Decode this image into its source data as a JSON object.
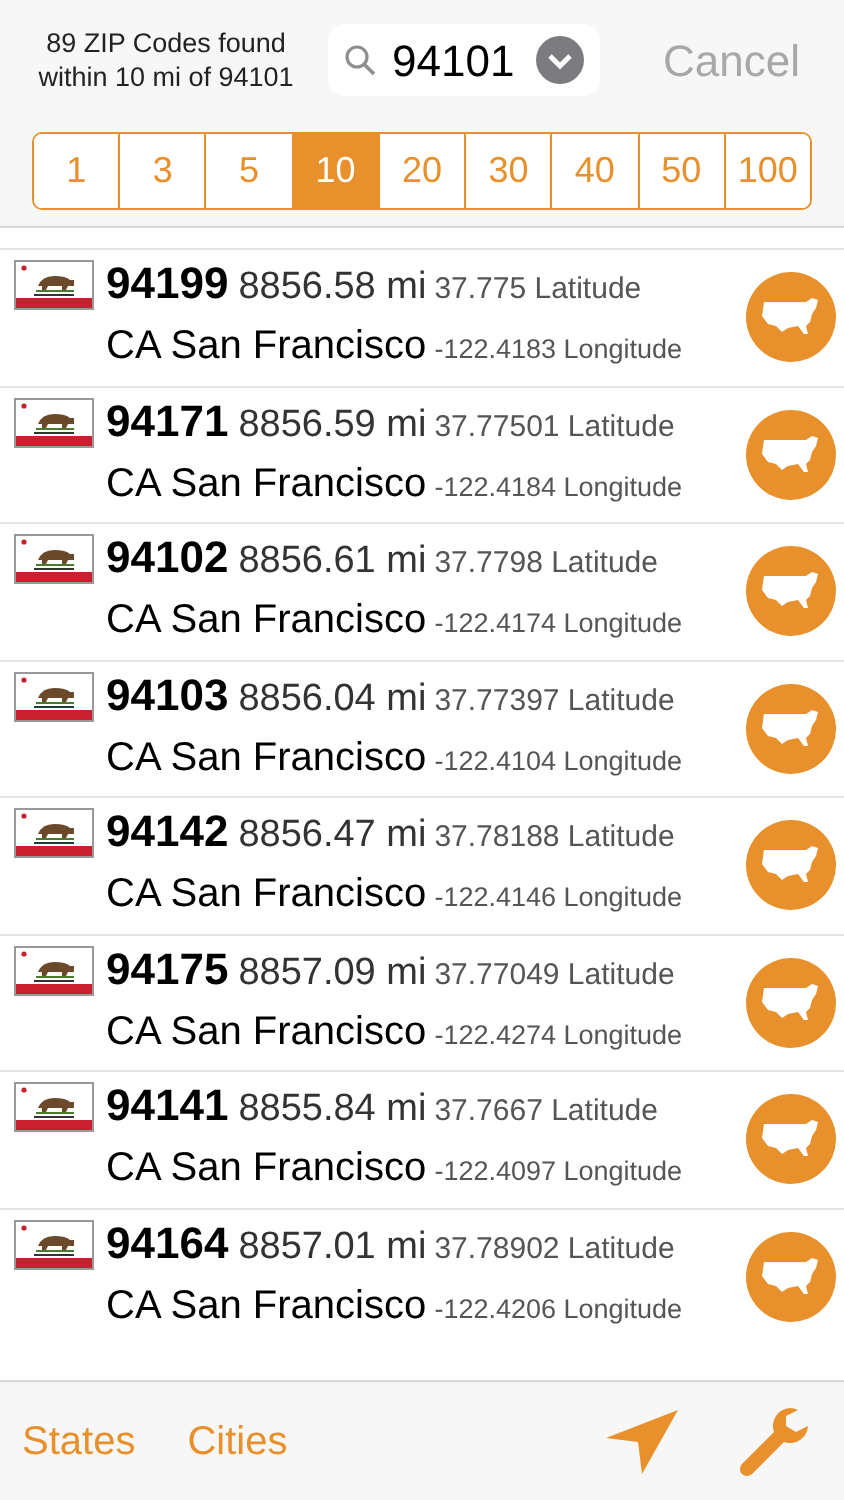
{
  "header": {
    "summary": "89 ZIP Codes found within 10 mi of 94101",
    "search": {
      "value": "94101"
    },
    "cancel": "Cancel"
  },
  "radius_options": [
    {
      "label": "1",
      "selected": false
    },
    {
      "label": "3",
      "selected": false
    },
    {
      "label": "5",
      "selected": false
    },
    {
      "label": "10",
      "selected": true
    },
    {
      "label": "20",
      "selected": false
    },
    {
      "label": "30",
      "selected": false
    },
    {
      "label": "40",
      "selected": false
    },
    {
      "label": "50",
      "selected": false
    },
    {
      "label": "100",
      "selected": false
    }
  ],
  "results": [
    {
      "zip": "94199",
      "distance": "8856.58 mi",
      "latitude": "37.775 Latitude",
      "place": "CA San Francisco",
      "longitude": "-122.4183 Longitude"
    },
    {
      "zip": "94171",
      "distance": "8856.59 mi",
      "latitude": "37.77501 Latitude",
      "place": "CA San Francisco",
      "longitude": "-122.4184 Longitude"
    },
    {
      "zip": "94102",
      "distance": "8856.61 mi",
      "latitude": "37.7798 Latitude",
      "place": "CA San Francisco",
      "longitude": "-122.4174 Longitude"
    },
    {
      "zip": "94103",
      "distance": "8856.04 mi",
      "latitude": "37.77397 Latitude",
      "place": "CA San Francisco",
      "longitude": "-122.4104 Longitude"
    },
    {
      "zip": "94142",
      "distance": "8856.47 mi",
      "latitude": "37.78188 Latitude",
      "place": "CA San Francisco",
      "longitude": "-122.4146 Longitude"
    },
    {
      "zip": "94175",
      "distance": "8857.09 mi",
      "latitude": "37.77049 Latitude",
      "place": "CA San Francisco",
      "longitude": "-122.4274 Longitude"
    },
    {
      "zip": "94141",
      "distance": "8855.84 mi",
      "latitude": "37.7667 Latitude",
      "place": "CA San Francisco",
      "longitude": "-122.4097 Longitude"
    },
    {
      "zip": "94164",
      "distance": "8857.01 mi",
      "latitude": "37.78902 Latitude",
      "place": "CA San Francisco",
      "longitude": "-122.4206 Longitude"
    }
  ],
  "toolbar": {
    "links": [
      "States",
      "Cities"
    ]
  }
}
